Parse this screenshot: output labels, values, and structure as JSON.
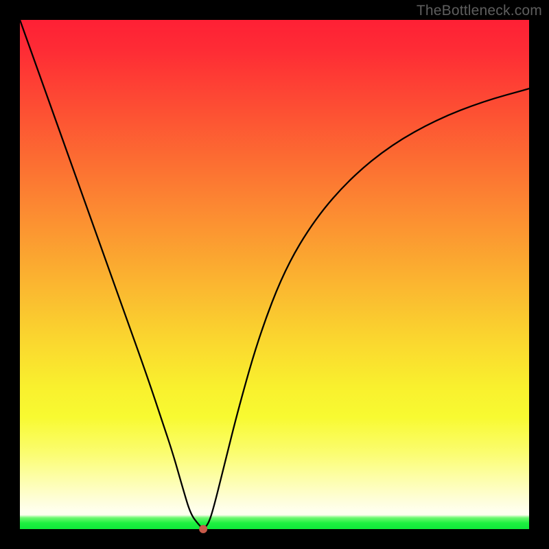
{
  "watermark": "TheBottleneck.com",
  "chart_data": {
    "type": "line",
    "title": "",
    "xlabel": "",
    "ylabel": "",
    "xlim": [
      0,
      100
    ],
    "ylim": [
      0,
      100
    ],
    "grid": false,
    "legend": false,
    "series": [
      {
        "name": "bottleneck-curve",
        "x": [
          0,
          5,
          10,
          15,
          20,
          25,
          28,
          30,
          32,
          33.5,
          35,
          36,
          37,
          38,
          40,
          43,
          47,
          52,
          58,
          65,
          73,
          82,
          91,
          100
        ],
        "y": [
          100,
          86,
          72,
          58,
          44,
          30,
          21,
          15,
          8,
          3,
          1,
          0,
          1,
          4,
          12,
          24,
          38,
          51,
          61,
          69,
          75.5,
          80.5,
          84,
          86.5
        ]
      }
    ],
    "marker": {
      "x": 36,
      "y": 0,
      "name": "optimal-point"
    },
    "gradient_stops": [
      {
        "pos": 0,
        "color": "#fe2035"
      },
      {
        "pos": 50,
        "color": "#fbb030"
      },
      {
        "pos": 78,
        "color": "#f8fa31"
      },
      {
        "pos": 96,
        "color": "#ffffef"
      },
      {
        "pos": 100,
        "color": "#0fe83a"
      }
    ]
  }
}
